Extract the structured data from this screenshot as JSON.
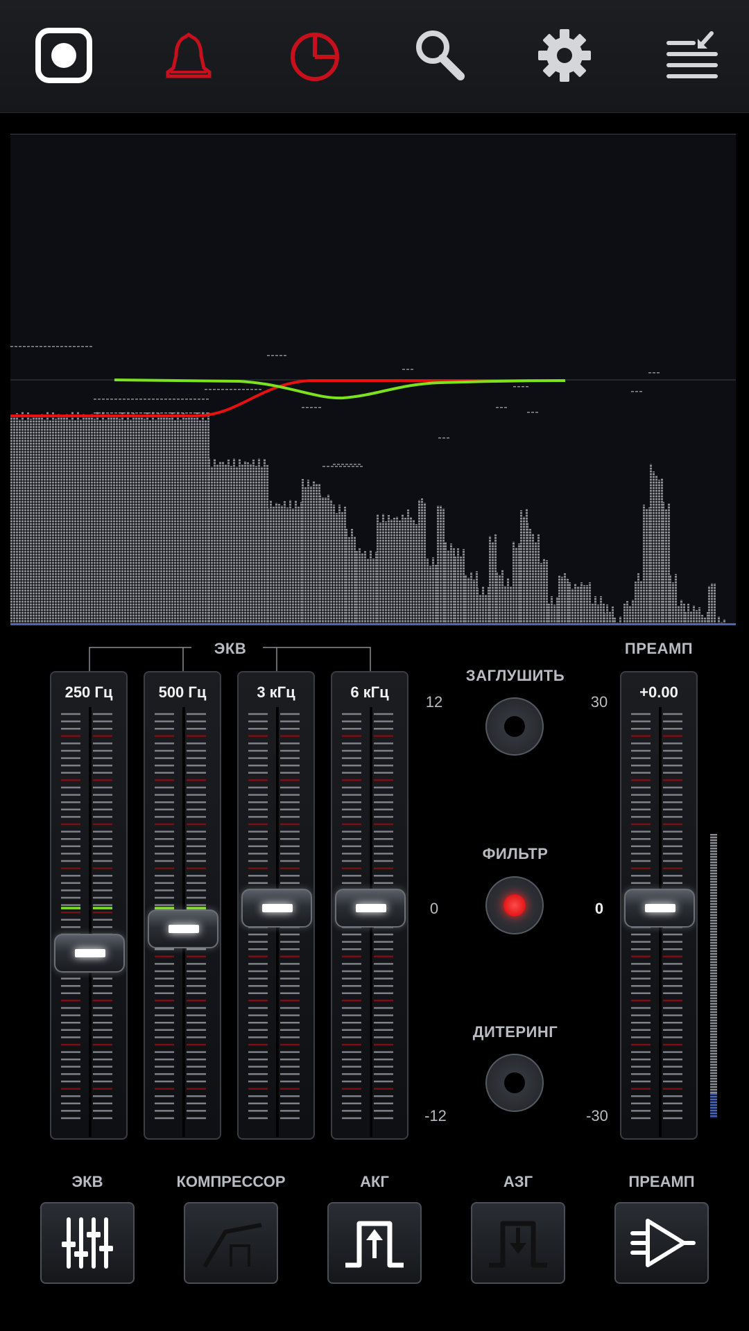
{
  "toolbar": {
    "icons": [
      "record-icon",
      "bell-icon",
      "timer-icon",
      "search-icon",
      "gear-icon",
      "menu-icon"
    ],
    "colors": {
      "active": "#ffffff",
      "alert": "#c8101c",
      "normal": "#d4d6da"
    }
  },
  "equalizer": {
    "group_label": "ЭКВ",
    "bands": [
      {
        "label": "250 Гц",
        "level": -2.8
      },
      {
        "label": "500 Гц",
        "level": -1.3
      },
      {
        "label": "3 кГц",
        "level": 0
      },
      {
        "label": "6 кГц",
        "level": 0
      }
    ],
    "scale": {
      "top": "12",
      "mid": "0",
      "bottom": "-12"
    }
  },
  "controls": {
    "mute_label": "ЗАГЛУШИТЬ",
    "filter_label": "ФИЛЬТР",
    "dither_label": "ДИТЕРИНГ",
    "filter_on": true
  },
  "preamp": {
    "label": "ПРЕАМП",
    "value": "+0.00",
    "scale": {
      "top": "30",
      "mid": "0",
      "bottom": "-30"
    }
  },
  "modules": [
    {
      "label": "ЭКВ",
      "icon": "equalizer-icon"
    },
    {
      "label": "КОМПРЕССОР",
      "icon": "compressor-icon"
    },
    {
      "label": "АКГ",
      "icon": "agc-icon"
    },
    {
      "label": "АЗГ",
      "icon": "limiter-icon"
    },
    {
      "label": "ПРЕАМП",
      "icon": "amplifier-icon"
    }
  ],
  "spectrum": {
    "curve_colors": {
      "eq": "#7de21e",
      "filter": "#e81010"
    },
    "bar_color": "#9a9ca0"
  }
}
